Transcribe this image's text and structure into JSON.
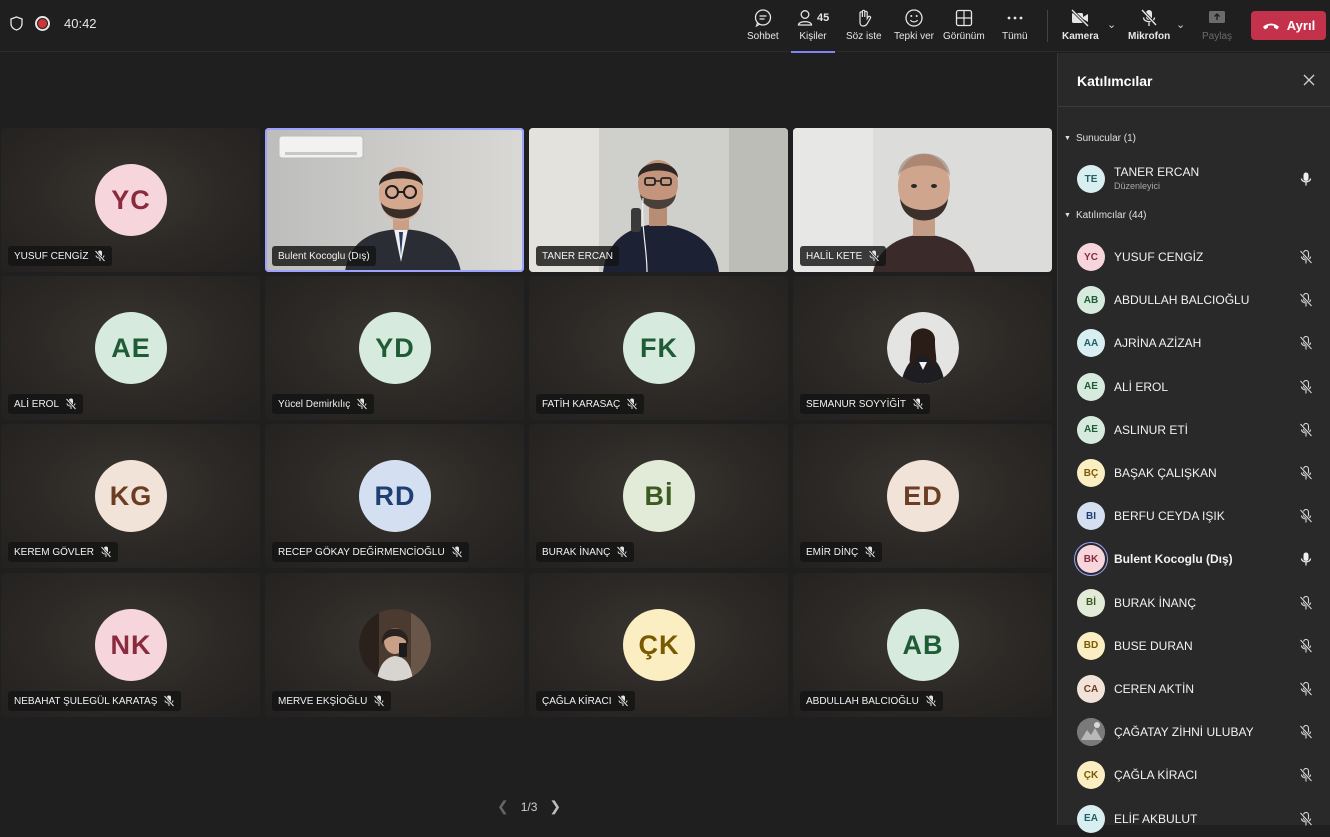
{
  "topbar": {
    "timer": "40:42",
    "people_count": "45",
    "buttons": {
      "chat": "Sohbet",
      "people": "Kişiler",
      "raise": "Söz iste",
      "react": "Tepki ver",
      "view": "Görünüm",
      "more": "Tümü",
      "camera": "Kamera",
      "mic": "Mikrofon",
      "share": "Paylaş"
    },
    "leave": "Ayrıl"
  },
  "stage": {
    "tiles": [
      {
        "name": "YUSUF CENGİZ",
        "initials": "YC",
        "color": "#f6d6dc",
        "text_color": "#8a2a3d",
        "muted": true,
        "type": "avatar"
      },
      {
        "name": "Bulent Kocoglu (Dış)",
        "initials": "",
        "color": "",
        "text_color": "",
        "muted": false,
        "type": "video-1"
      },
      {
        "name": "TANER ERCAN",
        "initials": "",
        "color": "",
        "text_color": "",
        "muted": false,
        "type": "video-2"
      },
      {
        "name": "HALİL KETE",
        "initials": "",
        "color": "",
        "text_color": "",
        "muted": true,
        "type": "video-3"
      },
      {
        "name": "ALİ EROL",
        "initials": "AE",
        "color": "#d6ebde",
        "text_color": "#1f5b35",
        "muted": true,
        "type": "avatar"
      },
      {
        "name": "Yücel Demirkılıç",
        "initials": "YD",
        "color": "#d6ebde",
        "text_color": "#1f5b35",
        "muted": true,
        "type": "avatar"
      },
      {
        "name": "FATİH KARASAÇ",
        "initials": "FK",
        "color": "#d6ebde",
        "text_color": "#1f5b35",
        "muted": true,
        "type": "avatar"
      },
      {
        "name": "SEMANUR SOYYİĞİT",
        "initials": "",
        "color": "#e9e9e9",
        "text_color": "#333",
        "muted": true,
        "type": "photo-avatar"
      },
      {
        "name": "KEREM GÖVLER",
        "initials": "KG",
        "color": "#f1e3d8",
        "text_color": "#6b3d22",
        "muted": true,
        "type": "avatar"
      },
      {
        "name": "RECEP GÖKAY DEĞİRMENCİOĞLU",
        "initials": "RD",
        "color": "#d4e0f2",
        "text_color": "#1f3f73",
        "muted": true,
        "type": "avatar"
      },
      {
        "name": "BURAK İNANÇ",
        "initials": "Bİ",
        "color": "#e2ebd8",
        "text_color": "#3b5a1f",
        "muted": true,
        "type": "avatar"
      },
      {
        "name": "EMİR DİNÇ",
        "initials": "ED",
        "color": "#f1e3d8",
        "text_color": "#6b3d22",
        "muted": true,
        "type": "avatar"
      },
      {
        "name": "NEBAHAT ŞULEGÜL KARATAŞ",
        "initials": "NK",
        "color": "#f6d6dc",
        "text_color": "#8a2a3d",
        "muted": true,
        "type": "avatar"
      },
      {
        "name": "MERVE EKŞİOĞLU",
        "initials": "",
        "color": "#3a2e28",
        "text_color": "#fff",
        "muted": true,
        "type": "photo-avatar-2"
      },
      {
        "name": "ÇAĞLA KİRACI",
        "initials": "ÇK",
        "color": "#fbeec2",
        "text_color": "#7a5a00",
        "muted": true,
        "type": "avatar"
      },
      {
        "name": "ABDULLAH BALCIOĞLU",
        "initials": "AB",
        "color": "#d6ebde",
        "text_color": "#1f5b35",
        "muted": true,
        "type": "avatar"
      }
    ],
    "page": "1/3"
  },
  "panel": {
    "title": "Katılımcılar",
    "presenters_label": "Sunucular (1)",
    "attendees_label": "Katılımcılar (44)",
    "presenter": {
      "name": "TANER ERCAN",
      "role": "Düzenleyici",
      "initials": "TE",
      "color": "#d8eef0",
      "text_color": "#1f5f66"
    },
    "people": [
      {
        "name": "YUSUF CENGİZ",
        "initials": "YC",
        "color": "#f6d6dc",
        "text_color": "#8a2a3d",
        "muted": true
      },
      {
        "name": "ABDULLAH BALCIOĞLU",
        "initials": "AB",
        "color": "#d6ebde",
        "text_color": "#1f5b35",
        "muted": true
      },
      {
        "name": "AJRİNA AZİZAH",
        "initials": "AA",
        "color": "#d8eef0",
        "text_color": "#1f5f66",
        "muted": true
      },
      {
        "name": "ALİ EROL",
        "initials": "AE",
        "color": "#d6ebde",
        "text_color": "#1f5b35",
        "muted": true
      },
      {
        "name": "ASLINUR ETİ",
        "initials": "AE",
        "color": "#d6ebde",
        "text_color": "#1f5b35",
        "muted": true
      },
      {
        "name": "BAŞAK ÇALIŞKAN",
        "initials": "BÇ",
        "color": "#fbeec2",
        "text_color": "#7a5a00",
        "muted": true
      },
      {
        "name": "BERFU CEYDA IŞIK",
        "initials": "BI",
        "color": "#d4e0f2",
        "text_color": "#1f3f73",
        "muted": true
      },
      {
        "name": "Bulent Kocoglu (Dış)",
        "initials": "BK",
        "color": "#f6d6dc",
        "text_color": "#8a2a3d",
        "muted": false,
        "speaking": true
      },
      {
        "name": "BURAK İNANÇ",
        "initials": "Bİ",
        "color": "#e2ebd8",
        "text_color": "#3b5a1f",
        "muted": true
      },
      {
        "name": "BUSE DURAN",
        "initials": "BD",
        "color": "#fbeec2",
        "text_color": "#7a5a00",
        "muted": true
      },
      {
        "name": "CEREN AKTİN",
        "initials": "CA",
        "color": "#f1e3d8",
        "text_color": "#6b3d22",
        "muted": true
      },
      {
        "name": "ÇAĞATAY ZİHNİ ULUBAY",
        "initials": "",
        "color": "#6f6f6f",
        "text_color": "#fff",
        "muted": true,
        "photo": true
      },
      {
        "name": "ÇAĞLA KİRACI",
        "initials": "ÇK",
        "color": "#fbeec2",
        "text_color": "#7a5a00",
        "muted": true
      },
      {
        "name": "ELİF AKBULUT",
        "initials": "EA",
        "color": "#d8eef0",
        "text_color": "#1f5f66",
        "muted": true
      }
    ]
  },
  "colors": {
    "accent": "#7f85f5",
    "leave": "#c4314b",
    "background": "#1f1f1f",
    "panel": "#292929"
  }
}
